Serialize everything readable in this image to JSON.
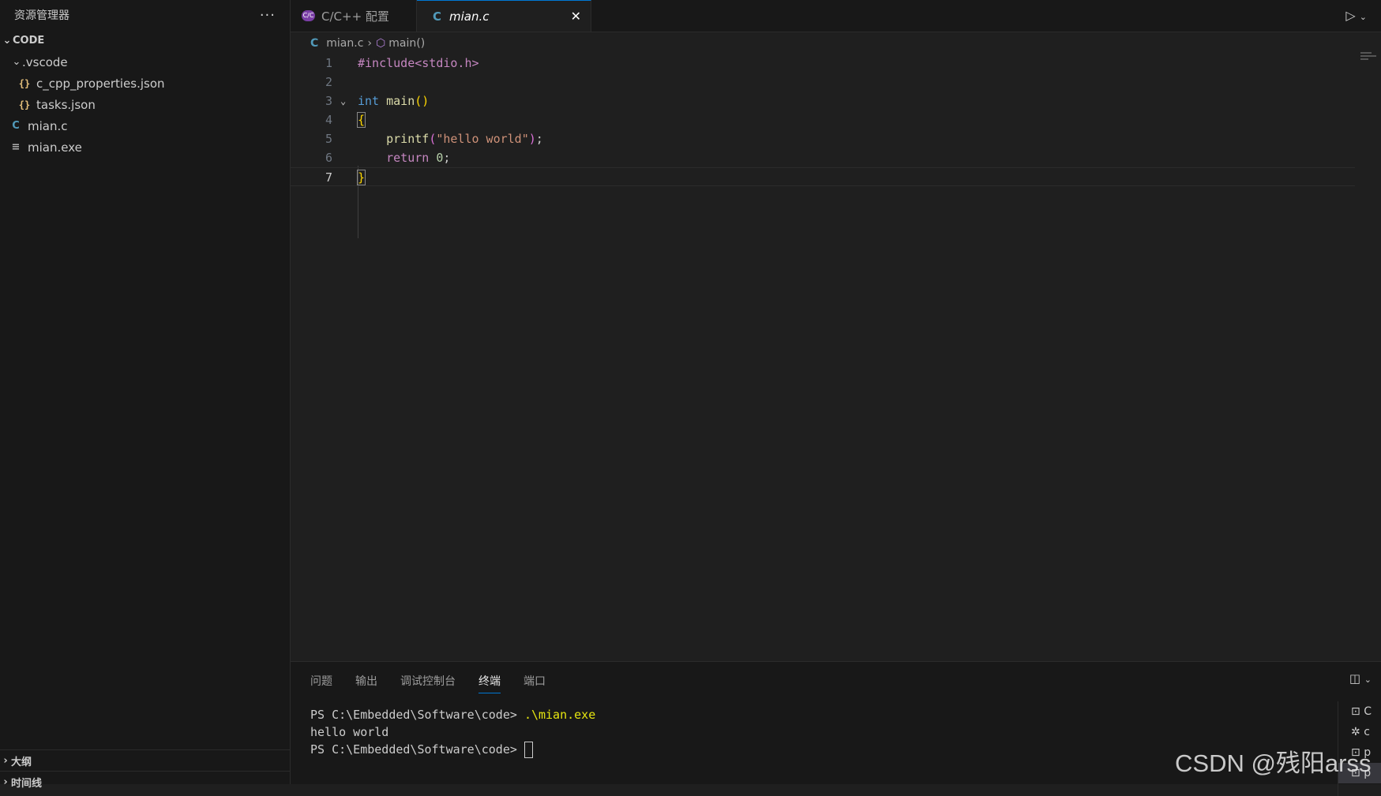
{
  "sidebar": {
    "title": "资源管理器",
    "more_label": "···",
    "folder": "CODE",
    "items": [
      {
        "label": ".vscode",
        "type": "folder"
      },
      {
        "label": "c_cpp_properties.json",
        "type": "json",
        "icon": "{}"
      },
      {
        "label": "tasks.json",
        "type": "json",
        "icon": "{}"
      },
      {
        "label": "mian.c",
        "type": "c",
        "icon": "C"
      },
      {
        "label": "mian.exe",
        "type": "exe",
        "icon": "≡"
      }
    ],
    "outline": "大纲",
    "timeline": "时间线"
  },
  "tabs": {
    "config": {
      "label": "C/C++ 配置",
      "icon": "C/C"
    },
    "main": {
      "label": "mian.c",
      "icon": "C",
      "close": "✕"
    }
  },
  "breadcrumb": {
    "file": "mian.c",
    "symbol": "main()",
    "file_icon": "C",
    "sep": "›",
    "symbol_icon": "⬡"
  },
  "editor": {
    "line_numbers": [
      "1",
      "2",
      "3",
      "4",
      "5",
      "6",
      "7"
    ],
    "code": {
      "l1": "#include<stdio.h>",
      "l3_kw": "int",
      "l3_fn": "main",
      "l3_paren": "()",
      "l4": "{",
      "l5_fn": "printf",
      "l5_open": "(",
      "l5_str": "\"hello world\"",
      "l5_close": ")",
      "l5_semi": ";",
      "l6_kw": "return",
      "l6_num": "0",
      "l6_semi": ";",
      "l7": "}"
    }
  },
  "panel": {
    "tabs": [
      "问题",
      "输出",
      "调试控制台",
      "终端",
      "端口"
    ],
    "active_tab": "终端",
    "terminal": {
      "prompt1": "PS C:\\Embedded\\Software\\code> ",
      "cmd1": ".\\mian.exe",
      "output": "hello world",
      "prompt2": "PS C:\\Embedded\\Software\\code> "
    },
    "term_list": [
      "C",
      "c",
      "p",
      "p"
    ]
  },
  "watermark": "CSDN @残阳arss"
}
